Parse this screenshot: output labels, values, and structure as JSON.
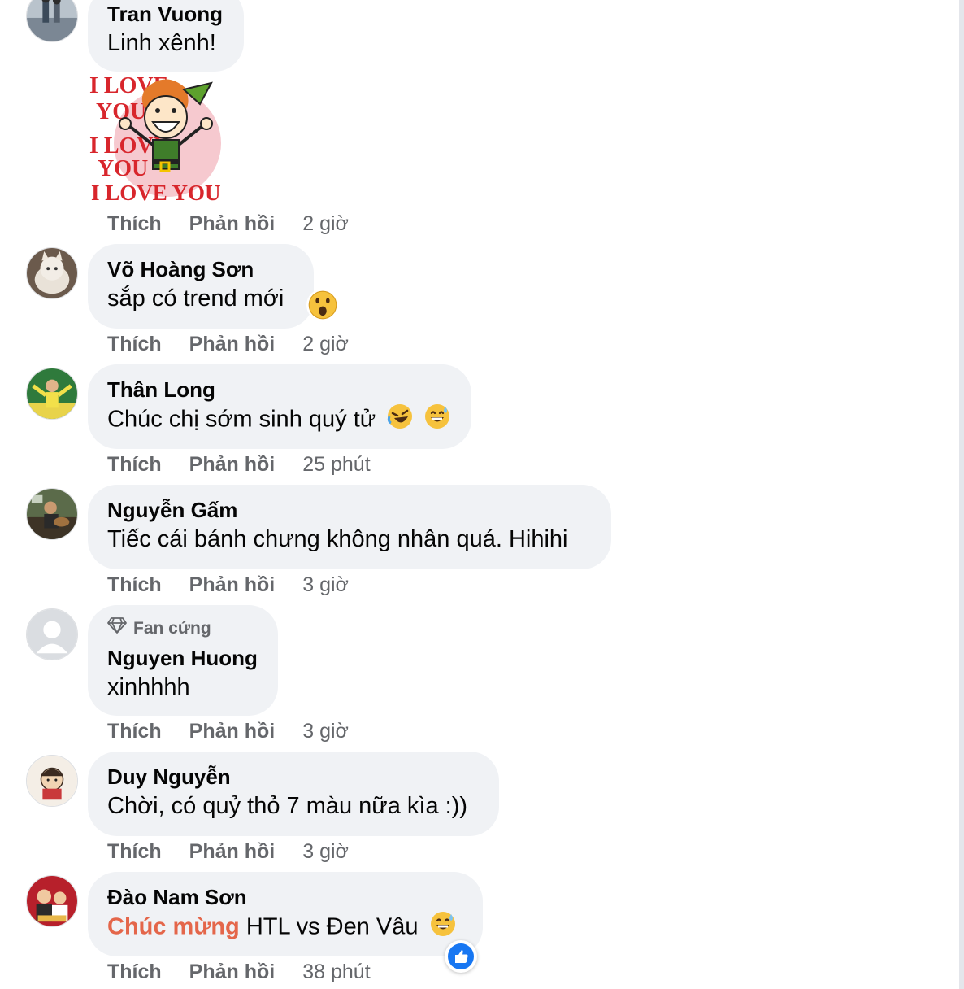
{
  "actions": {
    "like_label": "Thích",
    "reply_label": "Phản hồi"
  },
  "comments": [
    {
      "author": "Tran Vuong",
      "text": "Linh xênh!",
      "time": "2 giờ",
      "sticker": {
        "lines": [
          "I LOVE",
          "YOU",
          "I LOVE",
          "YOU",
          "I LOVE YOU!"
        ]
      }
    },
    {
      "author": "Võ Hoàng Sơn",
      "text": "sắp có trend mới",
      "time": "2 giờ",
      "emoji": [
        "surprised-face"
      ]
    },
    {
      "author": "Thân Long",
      "text": "Chúc chị sớm sinh quý tử",
      "time": "25 phút",
      "emoji": [
        "rolling-laughing-face",
        "grinning-sweat-face"
      ]
    },
    {
      "author": "Nguyễn Gấm",
      "text": "Tiếc cái bánh chưng không nhân quá. Hihihi",
      "time": "3 giờ"
    },
    {
      "author": "Nguyen Huong",
      "badge": "Fan cứng",
      "text": "xinhhhh",
      "time": "3 giờ"
    },
    {
      "author": "Duy Nguyễn",
      "text": "Chời, có quỷ thỏ 7 màu nữa kìa :))",
      "time": "3 giờ"
    },
    {
      "author": "Đào Nam Sơn",
      "highlight": "Chúc mừng",
      "text": " HTL vs Đen Vâu",
      "time": "38 phút",
      "emoji": [
        "grinning-sweat-face"
      ],
      "reaction": "like"
    }
  ],
  "colors": {
    "bubble": "#f0f2f5",
    "meta": "#65676b",
    "highlight": "#e4664a",
    "like_blue": "#1877f2"
  }
}
